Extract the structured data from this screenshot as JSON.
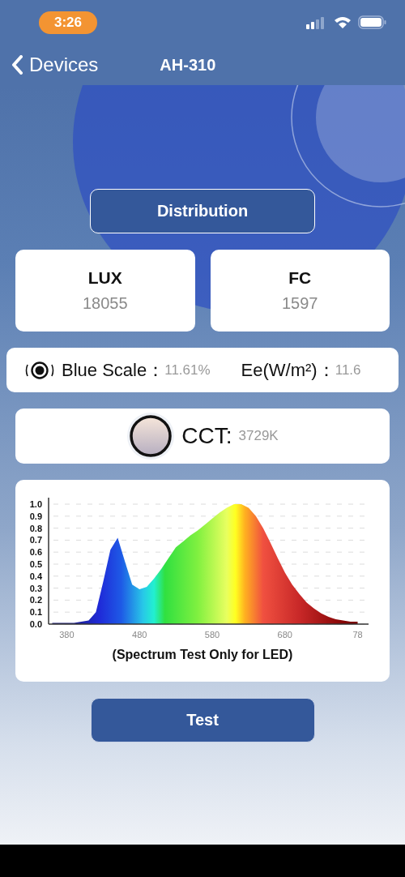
{
  "status_bar": {
    "time": "3:26"
  },
  "nav": {
    "back_label": "Devices",
    "title": "AH-310"
  },
  "mode_button": "Distribution",
  "readings": [
    {
      "label": "LUX",
      "value": "18055"
    },
    {
      "label": "FC",
      "value": "1597"
    }
  ],
  "blue_row": {
    "blue_label": "Blue Scale：",
    "blue_value": "11.61%",
    "ee_label": "Ee(W/m²)：",
    "ee_value": "11.6"
  },
  "cct": {
    "label": "CCT:",
    "value": "3729K"
  },
  "spectrum": {
    "chart_data": {
      "type": "area",
      "xlabel": "(Spectrum Test Only for LED)",
      "x": [
        360,
        370,
        380,
        390,
        400,
        410,
        420,
        430,
        440,
        450,
        460,
        470,
        480,
        490,
        500,
        510,
        520,
        530,
        540,
        550,
        560,
        570,
        580,
        590,
        600,
        610,
        620,
        630,
        640,
        650,
        660,
        670,
        680,
        690,
        700,
        710,
        720,
        730,
        740,
        750,
        760,
        770,
        780
      ],
      "series": [
        {
          "values": [
            0.01,
            0.01,
            0.01,
            0.01,
            0.02,
            0.03,
            0.1,
            0.35,
            0.62,
            0.72,
            0.52,
            0.33,
            0.29,
            0.31,
            0.38,
            0.46,
            0.55,
            0.64,
            0.69,
            0.74,
            0.78,
            0.83,
            0.88,
            0.93,
            0.97,
            1.0,
            1.0,
            0.97,
            0.9,
            0.8,
            0.68,
            0.55,
            0.43,
            0.33,
            0.25,
            0.18,
            0.13,
            0.09,
            0.06,
            0.04,
            0.03,
            0.02,
            0.02
          ]
        }
      ],
      "xlim": [
        355,
        795
      ],
      "ylim": [
        0,
        1
      ],
      "xticks": [
        380,
        480,
        580,
        680
      ],
      "grid": true,
      "yticks": [
        {
          "value": 0,
          "label": "0.0"
        },
        {
          "value": 0.1,
          "label": "0.1"
        },
        {
          "value": 0.2,
          "label": "0.2"
        },
        {
          "value": 0.3,
          "label": "0.3"
        },
        {
          "value": 0.4,
          "label": "0.4"
        },
        {
          "value": 0.5,
          "label": "0.5"
        },
        {
          "value": 0.6,
          "label": "0.6"
        },
        {
          "value": 0.7,
          "label": "0.7"
        },
        {
          "value": 0.8,
          "label": "0.8"
        },
        {
          "value": 0.9,
          "label": "0.9"
        },
        {
          "value": 1,
          "label": "1.0"
        }
      ]
    },
    "cut_tick_label": "78"
  },
  "test_button": "Test"
}
